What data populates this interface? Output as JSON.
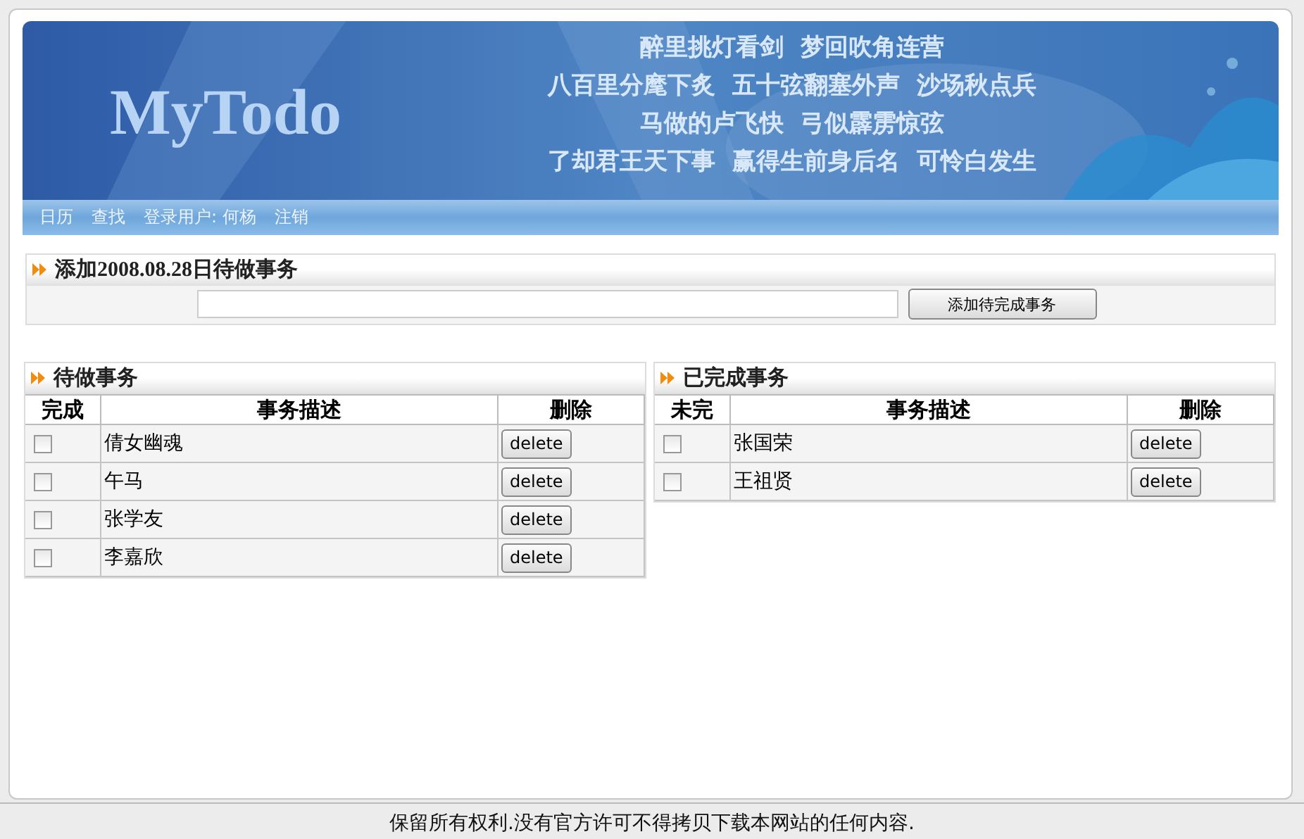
{
  "header": {
    "logo": "MyTodo",
    "poem": [
      "醉里挑灯看剑  梦回吹角连营",
      "八百里分麾下炙  五十弦翻塞外声  沙场秋点兵",
      "马做的卢飞快  弓似霹雳惊弦",
      "了却君王天下事  赢得生前身后名  可怜白发生"
    ],
    "nav": [
      "日历",
      "查找",
      "登录用户: 何杨",
      "注销"
    ]
  },
  "add_panel": {
    "title": "添加2008.08.28日待做事务",
    "button": "添加待完成事务"
  },
  "todo": {
    "title": "待做事务",
    "columns": [
      "完成",
      "事务描述",
      "删除"
    ],
    "rows": [
      {
        "checked": false,
        "description": "倩女幽魂",
        "action": "delete"
      },
      {
        "checked": false,
        "description": "午马",
        "action": "delete"
      },
      {
        "checked": false,
        "description": "张学友",
        "action": "delete"
      },
      {
        "checked": false,
        "description": "李嘉欣",
        "action": "delete"
      }
    ]
  },
  "done": {
    "title": "已完成事务",
    "columns": [
      "未完",
      "事务描述",
      "删除"
    ],
    "rows": [
      {
        "checked": false,
        "description": "张国荣",
        "action": "delete"
      },
      {
        "checked": false,
        "description": "王祖贤",
        "action": "delete"
      }
    ]
  },
  "footer": "保留所有权利.没有官方许可不得拷贝下载本网站的任何内容."
}
